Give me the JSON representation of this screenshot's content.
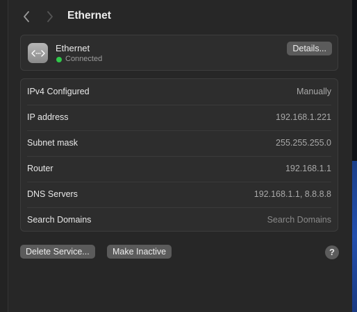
{
  "header": {
    "title": "Ethernet"
  },
  "status": {
    "name": "Ethernet",
    "state": "Connected",
    "details_label": "Details...",
    "dot_color": "#30c94a"
  },
  "info": {
    "rows": [
      {
        "label": "IPv4 Configured",
        "value": "Manually"
      },
      {
        "label": "IP address",
        "value": "192.168.1.221"
      },
      {
        "label": "Subnet mask",
        "value": "255.255.255.0"
      },
      {
        "label": "Router",
        "value": "192.168.1.1"
      },
      {
        "label": "DNS Servers",
        "value": "192.168.1.1, 8.8.8.8"
      },
      {
        "label": "Search Domains",
        "placeholder": "Search Domains"
      }
    ]
  },
  "actions": {
    "delete_label": "Delete Service...",
    "inactive_label": "Make Inactive",
    "help_label": "?"
  },
  "icons": {
    "back": "chevron-left-icon",
    "forward": "chevron-right-icon",
    "ethernet": "ethernet-port-icon"
  }
}
